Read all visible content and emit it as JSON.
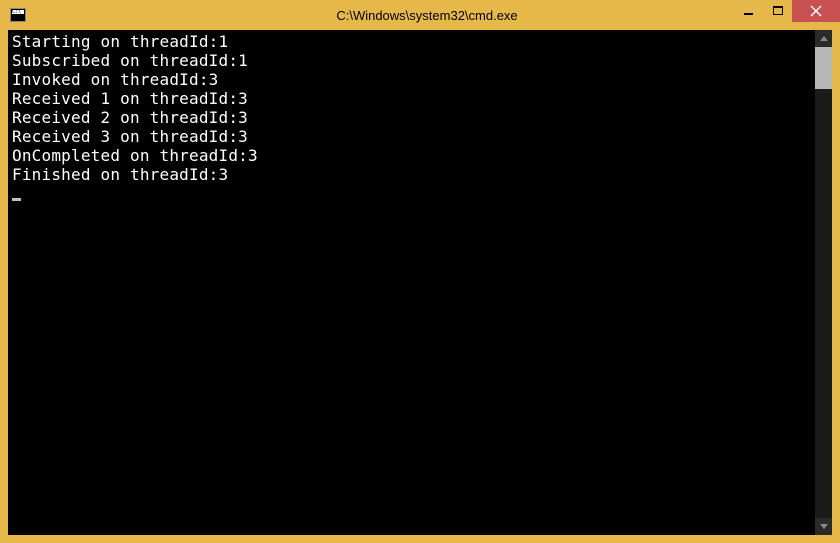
{
  "window": {
    "title": "C:\\Windows\\system32\\cmd.exe"
  },
  "console": {
    "lines": [
      "Starting on threadId:1",
      "Subscribed on threadId:1",
      "Invoked on threadId:3",
      "Received 1 on threadId:3",
      "Received 2 on threadId:3",
      "Received 3 on threadId:3",
      "OnCompleted on threadId:3",
      "Finished on threadId:3"
    ]
  }
}
